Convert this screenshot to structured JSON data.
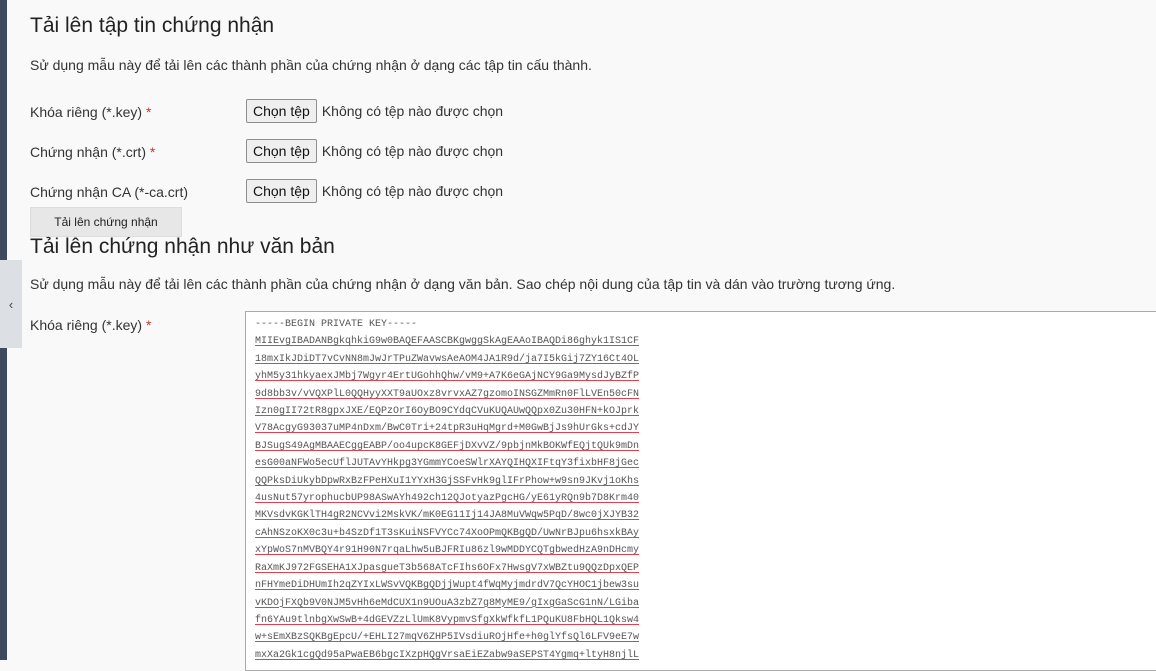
{
  "section1": {
    "title": "Tải lên tập tin chứng nhận",
    "description": "Sử dụng mẫu này để tải lên các thành phần của chứng nhận ở dạng các tập tin cấu thành.",
    "fields": [
      {
        "label": "Khóa riêng (*.key)",
        "required": "*",
        "button": "Chọn tệp",
        "status": "Không có tệp nào được chọn"
      },
      {
        "label": "Chứng nhận (*.crt)",
        "required": "*",
        "button": "Chọn tệp",
        "status": "Không có tệp nào được chọn"
      },
      {
        "label": "Chứng nhận CA (*-ca.crt)",
        "required": "",
        "button": "Chọn tệp",
        "status": "Không có tệp nào được chọn"
      }
    ],
    "submit_label": "Tải lên chứng nhận"
  },
  "section2": {
    "title": "Tải lên chứng nhận như văn bản",
    "description": "Sử dụng mẫu này để tải lên các thành phần của chứng nhận ở dạng văn bản. Sao chép nội dung của tập tin và dán vào trường tương ứng.",
    "key_label": "Khóa riêng (*.key)",
    "key_required": "*",
    "key_lines": [
      "-----BEGIN PRIVATE KEY-----",
      "MIIEvgIBADANBgkqhkiG9w0BAQEFAASCBKgwggSkAgEAAoIBAQDi86ghyk1IS1CF",
      "18mxIkJDiDT7vCvNN8mJwJrTPuZWavwsAeAOM4JA1R9d/ja7I5kGij7ZY16Ct4OL",
      "yhM5y31hkyaexJMbj7Wgyr4ErtUGohhQhw/vM9+A7K6eGAjNCY9Ga9MysdJyBZfP",
      "9d8bb3v/vVQXPlL0QQHyyXXT9aUOxz8vrvxAZ7gzomoINSGZMmRn0FlLVEn50cFN",
      "Izn0gII72tR8gpxJXE/EQPzOrI6OyBO9CYdqCVuKUQAUwQQpx0Zu30HFN+kOJprk",
      "V78AcgyG93037uMP4nDxm/BwC0Tri+24tpR3uHqMgrd+M0GwBjJs9hUrGks+cdJY",
      "BJSugS49AgMBAAECggEABP/oo4upcK8GEFjDXvVZ/9pbjnMkBOKWfEQjtQUk9mDn",
      "esG00aNFWo5ecUflJUTAvYHkpg3YGmmYCoeSWlrXAYQIHQXIFtqY3fixbHF8jGec",
      "QQPksDiUkybDpwRxBzFPeHXuI1YYxH3GjSSFvHk9glIFrPhow+w9sn9JKvj1oKhs",
      "4usNut57yrophucbUP98ASwAYh492ch12QJotyazPgcHG/yE61yRQn9b7D8Krm40",
      "MKVsdvKGKlTH4gR2NCVvi2MskVK/mK0EG11Ij14JA8MuVWqw5PqD/8wc0jXJYB32",
      "cAhNSzoKX0c3u+b4SzDf1T3sKuiNSFVYCc74XoOPmQKBgQD/UwNrBJpu6hsxkBAy",
      "xYpWoS7nMVBQY4r91H90N7rqaLhw5uBJFRIu86zl9wMDDYCQTgbwedHzA9nDHcmy",
      "RaXmKJ972FGSEHA1XJpasgueT3b568ATcFIhs6OFx7HwsgV7xWBZtu9QQzDpxQEP",
      "nFHYmeDiDHUmIh2qZYIxLWSvVQKBgQDjjWupt4fWqMyjmdrdV7QcYHOC1jbew3su",
      "vKDOjFXQb9V0NJM5vHh6eMdCUX1n9UOuA3zbZ7g8MyME9/gIxgGaScG1nN/LGiba",
      "fn6YAu9tlnbgXwSwB+4dGEVZzLlUmK8VypmvSfgXkWfkfL1PQuKU8FbHQL1Qksw4",
      "w+sEmXBzSQKBgEpcU/+EHLI27mqV6ZHP5IVsdiuROjHfe+h0glYfsQl6LFV9eE7w",
      "mxXa2Gk1cgQd95aPwaEB6bgcIXzpHQgVrsaEiEZabw9aSEPST4Ygmq+ltyH8njlL"
    ]
  }
}
